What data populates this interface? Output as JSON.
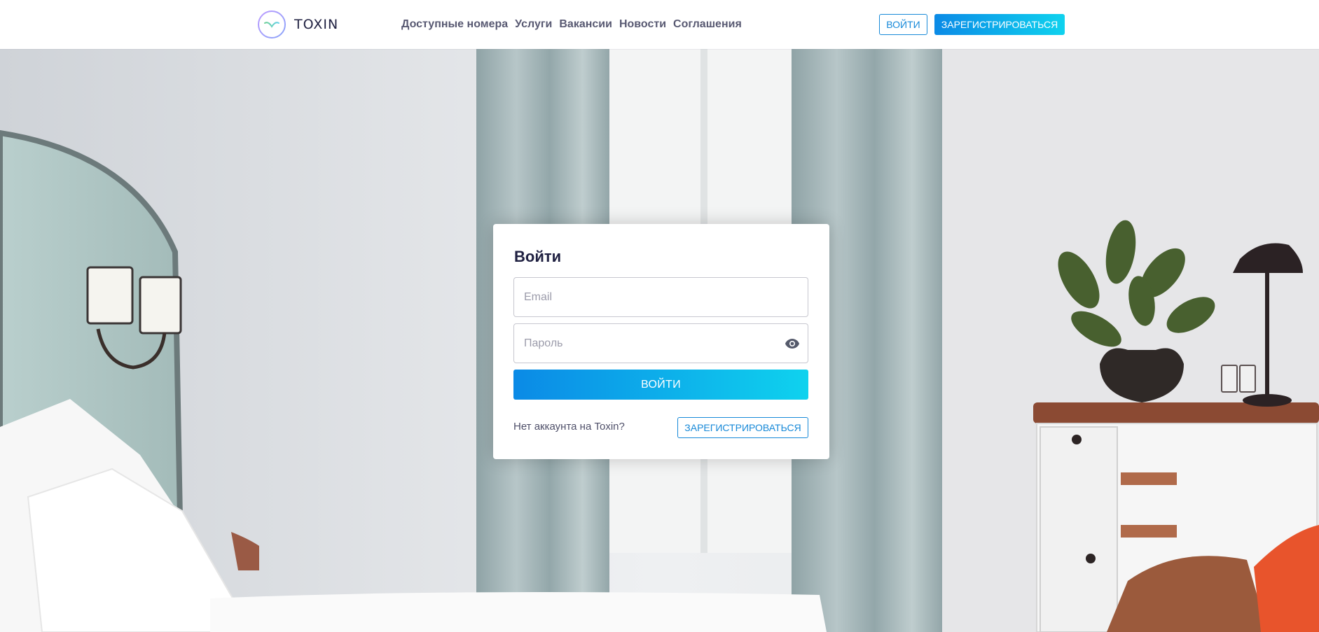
{
  "brand": {
    "name": "TOXIN",
    "accent_from": "#0b8ae6",
    "accent_to": "#0fd2ee",
    "outline": "#1789d8",
    "text_dark": "#1f2041"
  },
  "header": {
    "nav": [
      {
        "label": "Доступные номера"
      },
      {
        "label": "Услуги"
      },
      {
        "label": "Вакансии"
      },
      {
        "label": "Новости"
      },
      {
        "label": "Соглашения"
      }
    ],
    "login_label": "ВОЙТИ",
    "register_label": "ЗАРЕГИСТРИРОВАТЬСЯ"
  },
  "login_card": {
    "title": "Войти",
    "email": {
      "value": "",
      "placeholder": "Email"
    },
    "password": {
      "value": "",
      "placeholder": "Пароль",
      "toggle_icon": "eye-icon"
    },
    "submit_label": "ВОЙТИ",
    "no_account_text": "Нет аккаунта на Toxin?",
    "register_label": "ЗАРЕГИСТРИРОВАТЬСЯ"
  }
}
